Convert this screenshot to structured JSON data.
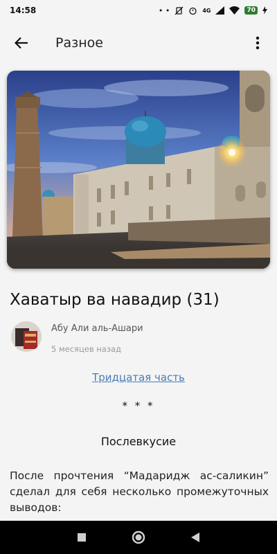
{
  "status_bar": {
    "time": "14:58",
    "dots": "• •",
    "network": "4G",
    "battery": "70"
  },
  "app_bar": {
    "title": "Разное",
    "back_icon": "arrow-left-icon",
    "menu_icon": "more-vert-icon"
  },
  "article": {
    "title": "Хаватыр ва навадир (31)",
    "author": "Абу Али аль-Ашари",
    "date": "5 месяцев назад",
    "link": "Тридцатая часть",
    "separator": "* * *",
    "subheading": "Послевкусие",
    "body": "После прочтения “Мадаридж ас-саликин” сделал для себя несколько промежуточных выводов:"
  },
  "nav_bar": {
    "icons": [
      "square-icon",
      "circle-icon",
      "triangle-back-icon"
    ]
  }
}
